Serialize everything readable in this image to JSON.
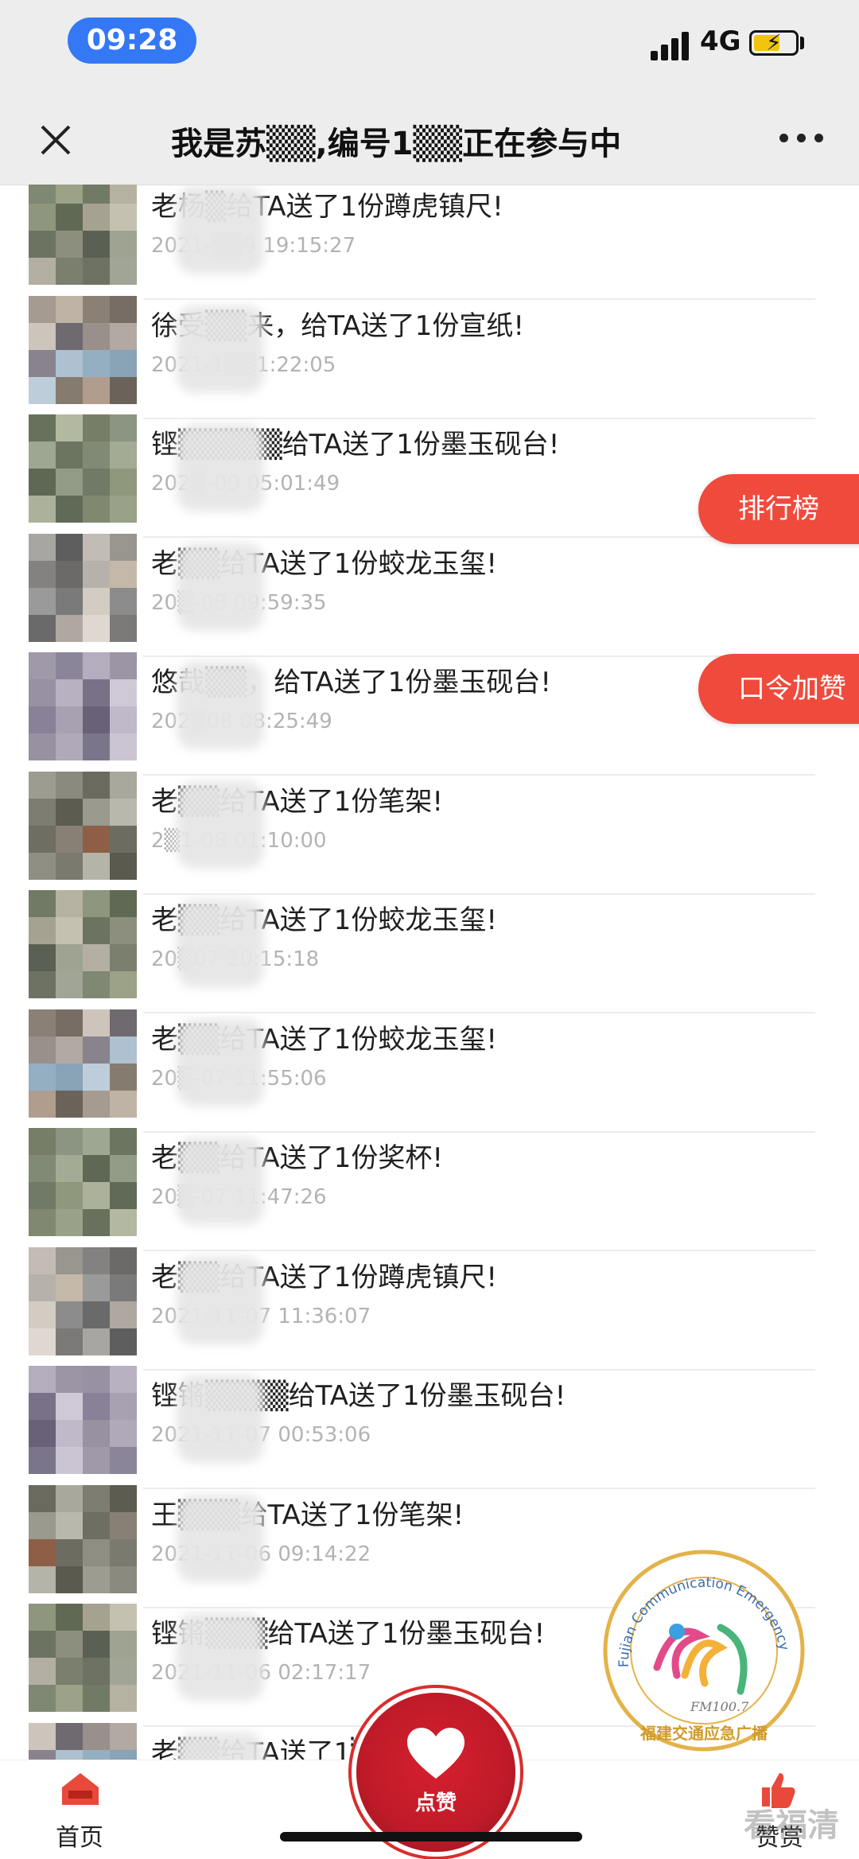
{
  "status_bar": {
    "time": "09:28",
    "network": "4G"
  },
  "nav": {
    "title": "我是苏▒▒,编号1▒▒正在参与中"
  },
  "list": [
    {
      "message": "老杨▒给TA送了1份蹲虎镇尺!",
      "time": "2021-▒▒9 19:15:27"
    },
    {
      "message": "徐受▒▒来，给TA送了1份宣纸!",
      "time": "2021-1▒▒1:22:05"
    },
    {
      "message": "铿▒▒▒▒▒给TA送了1份墨玉砚台!",
      "time": "202▒-09 05:01:49"
    },
    {
      "message": "老▒▒给TA送了1份蛟龙玉玺!",
      "time": "20▒-08 09:59:35"
    },
    {
      "message": "悠哉▒▒，给TA送了1份墨玉砚台!",
      "time": "202▒08 08:25:49"
    },
    {
      "message": "老▒▒给TA送了1份笔架!",
      "time": "2▒1-08 01:10:00"
    },
    {
      "message": "老▒▒给TA送了1份蛟龙玉玺!",
      "time": "20▒07 20:15:18"
    },
    {
      "message": "老▒▒给TA送了1份蛟龙玉玺!",
      "time": "20▒-07 11:55:06"
    },
    {
      "message": "老▒▒给TA送了1份奖杯!",
      "time": "20▒-07 11:47:26"
    },
    {
      "message": "老▒▒给TA送了1份蹲虎镇尺!",
      "time": "2021-11-07 11:36:07"
    },
    {
      "message": "铿锵▒▒▒▒给TA送了1份墨玉砚台!",
      "time": "2021-11-07 00:53:06"
    },
    {
      "message": "王▒▒▒给TA送了1份笔架!",
      "time": "2021-11-06 09:14:22"
    },
    {
      "message": "铿锵▒▒▒给TA送了1份墨玉砚台!",
      "time": "2021-11-06 02:17:17"
    },
    {
      "message": "老▒▒给TA送了1▒",
      "time": ""
    }
  ],
  "side_buttons": {
    "ranking": "排行榜",
    "code_like": "口令加赞"
  },
  "seal": {
    "ring_text": "Fujian Communication Emergency Radio",
    "freq": "FM100.7",
    "name": "福建交通应急广播"
  },
  "tabbar": {
    "home": "首页",
    "like": "点赞",
    "reward": "赞赏"
  },
  "watermark": "看福清",
  "colors": {
    "accent_red": "#f04a3c",
    "status_pill": "#3478f6"
  }
}
